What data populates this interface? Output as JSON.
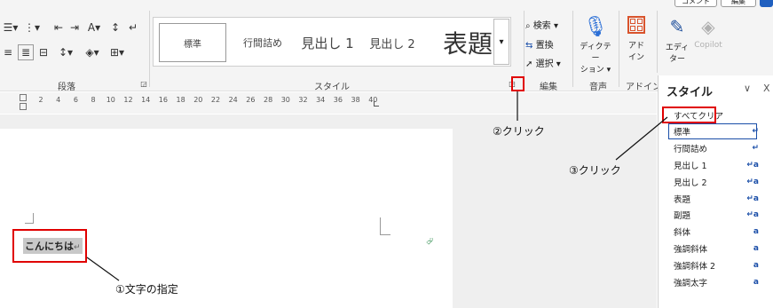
{
  "ribbon": {
    "paragraph_group_label": "段落",
    "style_group_label": "スタイル",
    "edit_group_label": "編集",
    "voice_group_label": "音声",
    "addin_group_label": "アドイン",
    "style_gallery": [
      "標準",
      "行間詰め",
      "見出し 1",
      "見出し 2",
      "表題"
    ],
    "find_label": "検索",
    "replace_label": "置換",
    "select_label": "選択",
    "dictate_label_1": "ディクテー",
    "dictate_label_2": "ション",
    "addin_label_1": "アド",
    "addin_label_2": "イン",
    "editor_label_1": "エディ",
    "editor_label_2": "ター",
    "copilot_label": "Copilot",
    "top_right_btn_1": "コメント",
    "top_right_btn_2": "編集"
  },
  "ruler": {
    "numbers": [
      "2",
      "4",
      "6",
      "8",
      "10",
      "12",
      "14",
      "16",
      "18",
      "20",
      "22",
      "24",
      "26",
      "28",
      "30",
      "32",
      "34",
      "36",
      "38",
      "40"
    ]
  },
  "document": {
    "selected_text": "こんにちは"
  },
  "styles_pane": {
    "title": "スタイル",
    "items": [
      {
        "label": "すべてクリア",
        "mark": ""
      },
      {
        "label": "標準",
        "mark": "↵"
      },
      {
        "label": "行間詰め",
        "mark": "↵"
      },
      {
        "label": "見出し 1",
        "mark": "↵a"
      },
      {
        "label": "見出し 2",
        "mark": "↵a"
      },
      {
        "label": "表題",
        "mark": "↵a"
      },
      {
        "label": "副題",
        "mark": "↵a"
      },
      {
        "label": "斜体",
        "mark": "a"
      },
      {
        "label": "強調斜体",
        "mark": "a"
      },
      {
        "label": "強調斜体 2",
        "mark": "a"
      },
      {
        "label": "強調太字",
        "mark": "a"
      }
    ]
  },
  "annotations": {
    "step1": "①文字の指定",
    "step2": "②クリック",
    "step3": "③クリック"
  },
  "colors": {
    "annotation_red": "#e00000",
    "selection_gray": "#c8c8c8",
    "pane_accent": "#1a4ea8"
  }
}
